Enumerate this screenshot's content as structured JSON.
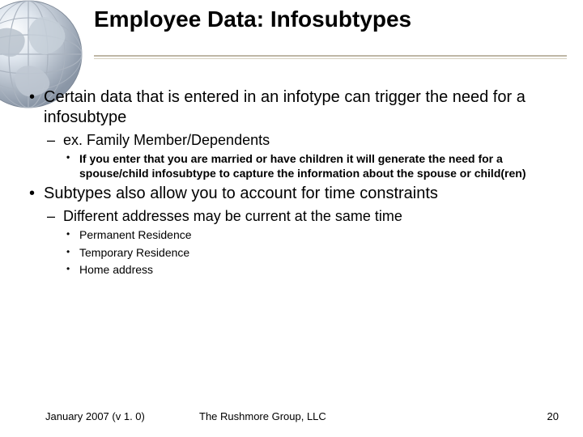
{
  "title": "Employee Data: Infosubtypes",
  "bullets": {
    "b1": "Certain data that is entered in an infotype can trigger the need for a infosubtype",
    "b1a": "ex. Family Member/Dependents",
    "b1a1": "If you enter that you are married or have children it will generate the need for a spouse/child infosubtype to capture the information about the spouse or child(ren)",
    "b2": "Subtypes also allow you to account for time constraints",
    "b2a": "Different addresses may be current at the same time",
    "b2a1": "Permanent Residence",
    "b2a2": "Temporary Residence",
    "b2a3": "Home address"
  },
  "footer": {
    "date": "January 2007 (v 1. 0)",
    "org": "The Rushmore Group, LLC",
    "pagenum": "20"
  }
}
